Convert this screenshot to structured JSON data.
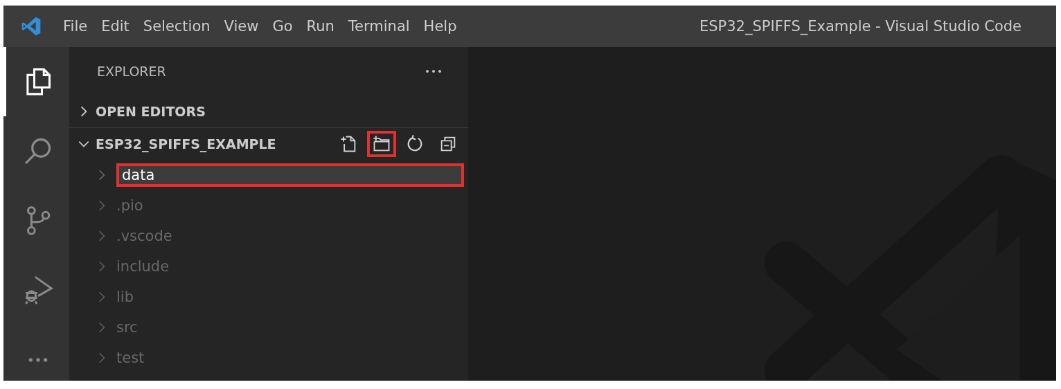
{
  "window": {
    "title": "ESP32_SPIFFS_Example - Visual Studio Code"
  },
  "menu": [
    {
      "label": "File"
    },
    {
      "label": "Edit"
    },
    {
      "label": "Selection"
    },
    {
      "label": "View"
    },
    {
      "label": "Go"
    },
    {
      "label": "Run"
    },
    {
      "label": "Terminal"
    },
    {
      "label": "Help"
    }
  ],
  "activity_bar": [
    {
      "kind": "explorer",
      "selected": true
    },
    {
      "kind": "search",
      "selected": false
    },
    {
      "kind": "source-control",
      "selected": false
    },
    {
      "kind": "run-debug",
      "selected": false
    },
    {
      "kind": "more",
      "selected": false
    }
  ],
  "sidebar": {
    "title": "EXPLORER",
    "sections": [
      {
        "label": "OPEN EDITORS",
        "expanded": false
      },
      {
        "label": "ESP32_SPIFFS_EXAMPLE",
        "expanded": true
      }
    ],
    "actions": [
      {
        "kind": "new-file",
        "highlighted": false
      },
      {
        "kind": "new-folder",
        "highlighted": true
      },
      {
        "kind": "refresh",
        "highlighted": false
      },
      {
        "kind": "collapse",
        "highlighted": false
      }
    ],
    "new_item_input": {
      "value": "data",
      "highlighted": true
    },
    "tree": [
      {
        "label": ".pio",
        "dimmed": true
      },
      {
        "label": ".vscode",
        "dimmed": true
      },
      {
        "label": "include",
        "dimmed": true
      },
      {
        "label": "lib",
        "dimmed": true
      },
      {
        "label": "src",
        "dimmed": true
      },
      {
        "label": "test",
        "dimmed": true
      }
    ]
  }
}
